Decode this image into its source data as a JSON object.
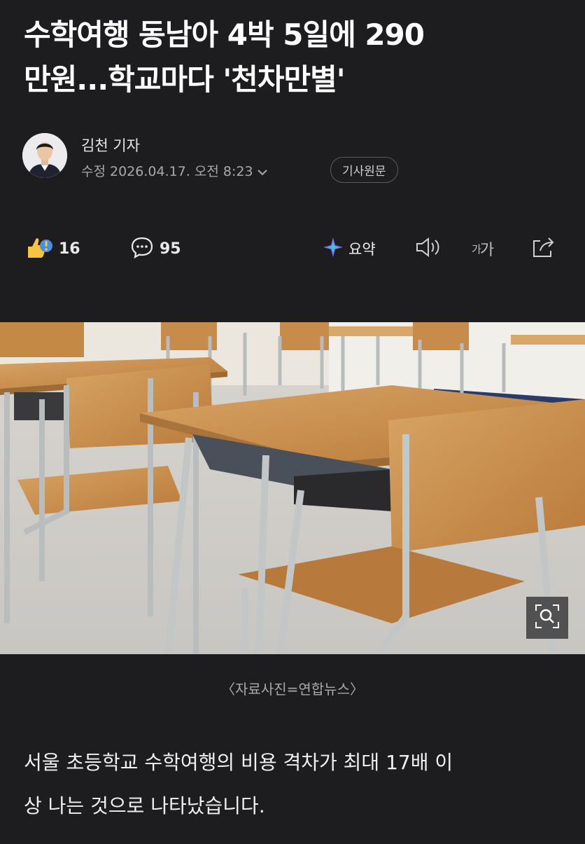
{
  "article": {
    "headline_line1": "수학여행 동남아 4박 5일에 290",
    "headline_line2": "만원...학교마다 '천차만별'",
    "author": "김천 기자",
    "meta": "수정 2026.04.17. 오전 8:23",
    "origin_label": "기사원문",
    "caption": "〈자료사진=연합뉴스〉",
    "body_line1": "서울 초등학교 수학여행의 비용 격차가 최대 17배 이",
    "body_line2": "상 나는 것으로 나타났습니다."
  },
  "actions": {
    "reaction_count": "16",
    "comment_count": "95",
    "summary_label": "요약",
    "font_size_small": "가",
    "font_size_large": "가"
  },
  "icons": {
    "reaction": "reaction-emoji-icon",
    "comment": "comment-bubble-icon",
    "summary": "ai-summary-sparkle-icon",
    "listen": "speaker-icon",
    "font": "font-size-icon",
    "share": "share-icon",
    "zoom": "zoom-magnifier-icon"
  },
  "colors": {
    "background": "#1d1d1f",
    "text_primary": "#ffffff",
    "text_secondary": "#a9a9ab"
  }
}
